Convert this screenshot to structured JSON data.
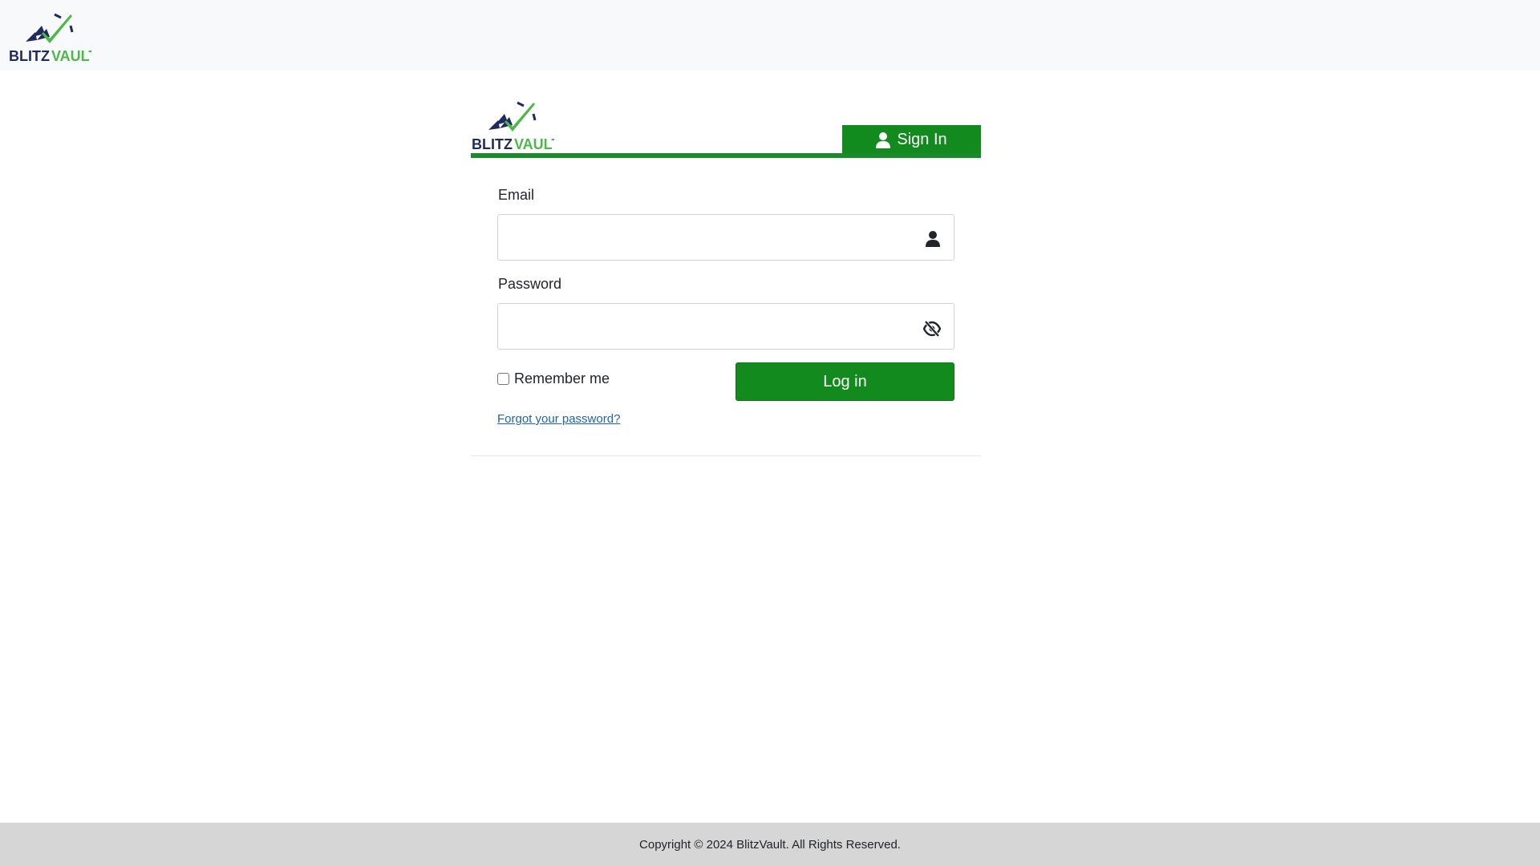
{
  "brand": {
    "logo_part1": "BLITZ",
    "logo_part2": "VAULT",
    "logo_icon": "checkmark-paper-plane-logo"
  },
  "colors": {
    "brand_green": "#138a1e",
    "logo_navy": "#1f2a5e",
    "logo_green": "#4cb848",
    "footer_bg": "#d6d6d6",
    "link": "#1e63b0"
  },
  "header": {
    "tab_label": "Sign In",
    "tab_icon": "user-icon"
  },
  "form": {
    "email_label": "Email",
    "email_value": "",
    "email_icon": "user-icon",
    "password_label": "Password",
    "password_value": "",
    "password_icon": "eye-slash-icon",
    "remember_label": "Remember me",
    "remember_checked": false,
    "login_label": "Log in",
    "forgot_label": "Forgot your password?"
  },
  "footer": {
    "copyright": "Copyright © 2024 BlitzVault. All Rights Reserved."
  }
}
